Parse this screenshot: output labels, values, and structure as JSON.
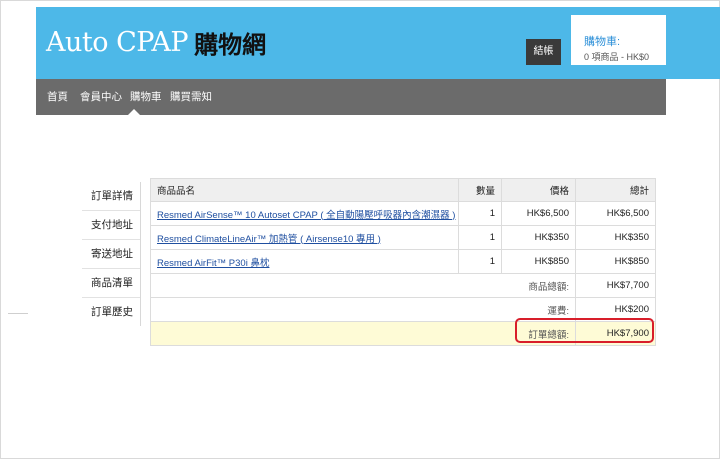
{
  "header": {
    "logo_en": "Auto CPAP",
    "logo_zh": "購物網",
    "checkout_label": "結帳",
    "cart_title": "購物車:",
    "cart_summary": "0 項商品 - HK$0"
  },
  "nav": {
    "items": [
      "首頁",
      "會員中心",
      "購物車",
      "購買需知"
    ]
  },
  "sidebar": {
    "items": [
      "訂單詳情",
      "支付地址",
      "寄送地址",
      "商品清單",
      "訂單歷史"
    ]
  },
  "table": {
    "headers": {
      "name": "商品品名",
      "qty": "數量",
      "price": "價格",
      "total": "總計"
    },
    "rows": [
      {
        "name": "Resmed AirSense™ 10 Autoset CPAP ( 全自動陽壓呼吸器內含潮濕器 )",
        "qty": "1",
        "price": "HK$6,500",
        "total": "HK$6,500"
      },
      {
        "name": "Resmed ClimateLineAir™ 加熱管 ( Airsense10 專用 )",
        "qty": "1",
        "price": "HK$350",
        "total": "HK$350"
      },
      {
        "name": "Resmed AirFit™ P30i 鼻枕",
        "qty": "1",
        "price": "HK$850",
        "total": "HK$850"
      }
    ],
    "summary": {
      "subtotal_label": "商品總額:",
      "subtotal_value": "HK$7,700",
      "shipping_label": "運費:",
      "shipping_value": "HK$200",
      "grand_label": "訂單總額:",
      "grand_value": "HK$7,900"
    }
  },
  "colors": {
    "header_bg": "#4db8e8",
    "nav_bg": "#6b6b6b",
    "highlight": "#d81e2a",
    "grand_row_bg": "#fefbd6"
  }
}
